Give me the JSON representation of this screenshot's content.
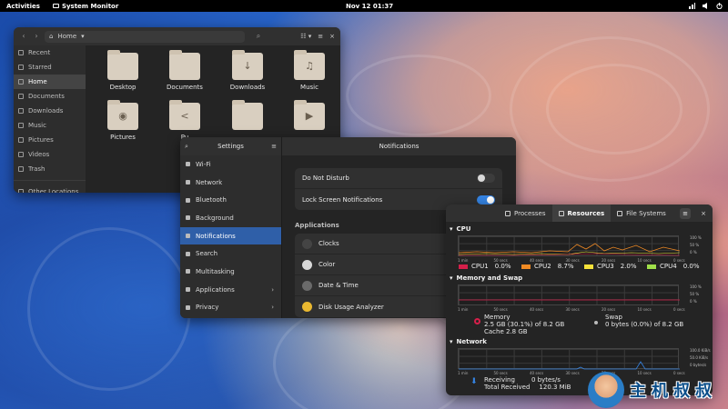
{
  "topbar": {
    "activities": "Activities",
    "app_name": "System Monitor",
    "clock": "Nov 12  01:37"
  },
  "files": {
    "path_label": "Home",
    "sidebar": [
      {
        "label": "Recent",
        "icon": "clock-icon"
      },
      {
        "label": "Starred",
        "icon": "star-icon"
      },
      {
        "label": "Home",
        "icon": "home-icon",
        "active": true
      },
      {
        "label": "Documents",
        "icon": "document-icon"
      },
      {
        "label": "Downloads",
        "icon": "download-icon"
      },
      {
        "label": "Music",
        "icon": "music-icon"
      },
      {
        "label": "Pictures",
        "icon": "picture-icon"
      },
      {
        "label": "Videos",
        "icon": "video-icon"
      },
      {
        "label": "Trash",
        "icon": "trash-icon"
      },
      {
        "label": "Other Locations",
        "icon": "plus-icon"
      }
    ],
    "folders": [
      {
        "label": "Desktop",
        "glyph": ""
      },
      {
        "label": "Documents",
        "glyph": ""
      },
      {
        "label": "Downloads",
        "glyph": "↓"
      },
      {
        "label": "Music",
        "glyph": "♫"
      },
      {
        "label": "Pictures",
        "glyph": "◉"
      },
      {
        "label": "Pu",
        "glyph": "<"
      },
      {
        "label": "",
        "glyph": ""
      },
      {
        "label": "",
        "glyph": "▶"
      }
    ]
  },
  "settings": {
    "title": "Settings",
    "panel_title": "Notifications",
    "sidebar": [
      {
        "label": "Wi-Fi"
      },
      {
        "label": "Network"
      },
      {
        "label": "Bluetooth"
      },
      {
        "label": "Background"
      },
      {
        "label": "Notifications",
        "active": true
      },
      {
        "label": "Search"
      },
      {
        "label": "Multitasking"
      },
      {
        "label": "Applications",
        "chevron": true
      },
      {
        "label": "Privacy",
        "chevron": true
      }
    ],
    "dnd_label": "Do Not Disturb",
    "lock_label": "Lock Screen Notifications",
    "applications_header": "Applications",
    "apps": [
      {
        "label": "Clocks",
        "color": "#444444"
      },
      {
        "label": "Color",
        "color": "#d8d8d8"
      },
      {
        "label": "Date & Time",
        "color": "#6a6a6a"
      },
      {
        "label": "Disk Usage Analyzer",
        "color": "#e9b830"
      }
    ]
  },
  "monitor": {
    "tabs": [
      {
        "label": "Processes"
      },
      {
        "label": "Resources",
        "active": true
      },
      {
        "label": "File Systems"
      }
    ],
    "cpu_title": "CPU",
    "mem_title": "Memory and Swap",
    "net_title": "Network",
    "y_labels": [
      "100 %",
      "50 %",
      "0 %"
    ],
    "net_y_labels": [
      "100.0 KiB/s",
      "50.0 KiB/s",
      "0 bytes/s"
    ],
    "x_labels": [
      "1 min",
      "50 secs",
      "40 secs",
      "30 secs",
      "20 secs",
      "10 secs",
      "0 secs"
    ],
    "cpus": [
      {
        "label": "CPU1",
        "value": "0.0%",
        "color": "#d51f4a"
      },
      {
        "label": "CPU2",
        "value": "8.7%",
        "color": "#f08a24"
      },
      {
        "label": "CPU3",
        "value": "2.0%",
        "color": "#f4e13a"
      },
      {
        "label": "CPU4",
        "value": "0.0%",
        "color": "#a0e04a"
      }
    ],
    "memory": {
      "label": "Memory",
      "line1": "2.5 GB (30.1%) of 8.2 GB",
      "line2": "Cache 2.8 GB"
    },
    "swap": {
      "label": "Swap",
      "line1": "0 bytes (0.0%) of 8.2 GB"
    },
    "receiving": {
      "label": "Receiving",
      "value": "0 bytes/s"
    },
    "total_received": {
      "label": "Total Received",
      "value": "120.3 MiB"
    }
  },
  "watermark": "主机叔叔"
}
